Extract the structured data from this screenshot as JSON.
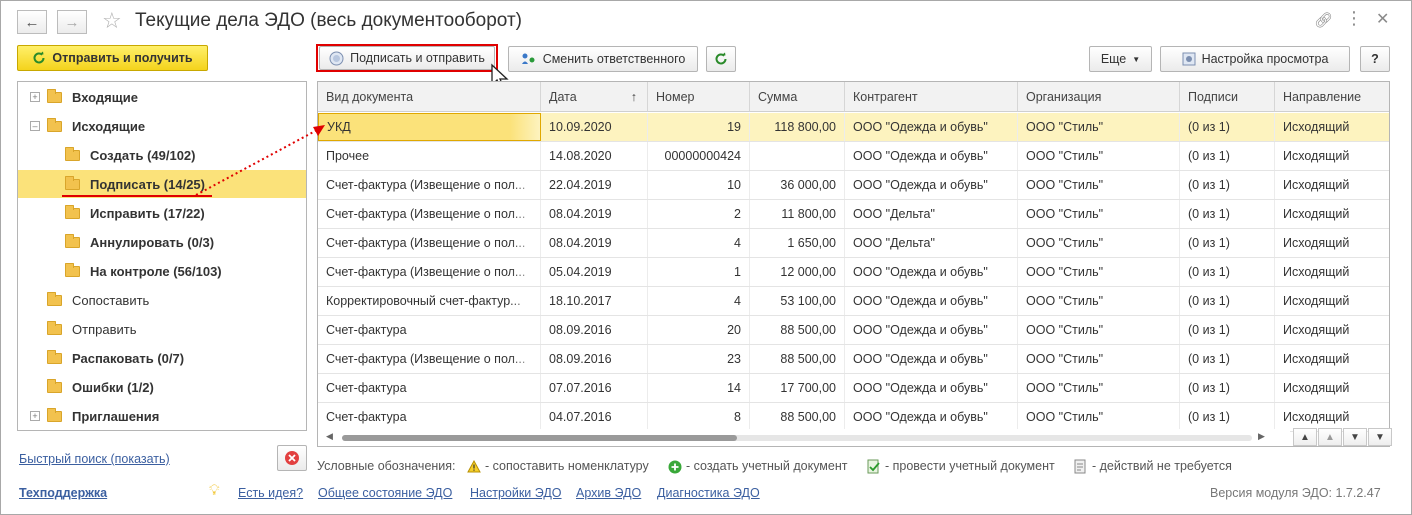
{
  "window": {
    "title": "Текущие дела ЭДО (весь документооборот)"
  },
  "toolbar": {
    "send_receive": "Отправить и получить",
    "sign_send": "Подписать и отправить",
    "change_responsible": "Сменить ответственного",
    "more": "Еще",
    "view_settings": "Настройка просмотра",
    "help": "?"
  },
  "tree": {
    "items": [
      {
        "label": "Входящие"
      },
      {
        "label": "Исходящие"
      },
      {
        "label": "Создать (49/102)"
      },
      {
        "label": "Подписать (14/25)"
      },
      {
        "label": "Исправить (17/22)"
      },
      {
        "label": "Аннулировать (0/3)"
      },
      {
        "label": "На контроле (56/103)"
      },
      {
        "label": "Сопоставить"
      },
      {
        "label": "Отправить"
      },
      {
        "label": "Распаковать (0/7)"
      },
      {
        "label": "Ошибки (1/2)"
      },
      {
        "label": "Приглашения"
      }
    ]
  },
  "grid": {
    "columns": [
      "Вид документа",
      "Дата",
      "Номер",
      "Сумма",
      "Контрагент",
      "Организация",
      "Подписи",
      "Направление"
    ],
    "sort_indicator": "↑",
    "rows": [
      [
        "УКД",
        "10.09.2020",
        "19",
        "118 800,00",
        "ООО \"Одежда и обувь\"",
        "ООО \"Стиль\"",
        "(0 из 1)",
        "Исходящий"
      ],
      [
        "Прочее",
        "14.08.2020",
        "00000000424",
        "",
        "ООО \"Одежда и обувь\"",
        "ООО \"Стиль\"",
        "(0 из 1)",
        "Исходящий"
      ],
      [
        "Счет-фактура (Извещение о пол...",
        "22.04.2019",
        "10",
        "36 000,00",
        "ООО \"Одежда и обувь\"",
        "ООО \"Стиль\"",
        "(0 из 1)",
        "Исходящий"
      ],
      [
        "Счет-фактура (Извещение о пол...",
        "08.04.2019",
        "2",
        "11 800,00",
        "ООО \"Дельта\"",
        "ООО \"Стиль\"",
        "(0 из 1)",
        "Исходящий"
      ],
      [
        "Счет-фактура (Извещение о пол...",
        "08.04.2019",
        "4",
        "1 650,00",
        "ООО \"Дельта\"",
        "ООО \"Стиль\"",
        "(0 из 1)",
        "Исходящий"
      ],
      [
        "Счет-фактура (Извещение о пол...",
        "05.04.2019",
        "1",
        "12 000,00",
        "ООО \"Одежда и обувь\"",
        "ООО \"Стиль\"",
        "(0 из 1)",
        "Исходящий"
      ],
      [
        "Корректировочный счет-фактур...",
        "18.10.2017",
        "4",
        "53 100,00",
        "ООО \"Одежда и обувь\"",
        "ООО \"Стиль\"",
        "(0 из 1)",
        "Исходящий"
      ],
      [
        "Счет-фактура",
        "08.09.2016",
        "20",
        "88 500,00",
        "ООО \"Одежда и обувь\"",
        "ООО \"Стиль\"",
        "(0 из 1)",
        "Исходящий"
      ],
      [
        "Счет-фактура (Извещение о пол...",
        "08.09.2016",
        "23",
        "88 500,00",
        "ООО \"Одежда и обувь\"",
        "ООО \"Стиль\"",
        "(0 из 1)",
        "Исходящий"
      ],
      [
        "Счет-фактура",
        "07.07.2016",
        "14",
        "17 700,00",
        "ООО \"Одежда и обувь\"",
        "ООО \"Стиль\"",
        "(0 из 1)",
        "Исходящий"
      ],
      [
        "Счет-фактура",
        "04.07.2016",
        "8",
        "88 500,00",
        "ООО \"Одежда и обувь\"",
        "ООО \"Стиль\"",
        "(0 из 1)",
        "Исходящий"
      ]
    ]
  },
  "legend": {
    "label": "Условные обозначения:",
    "items": [
      "- сопоставить номенклатуру",
      "- создать учетный документ",
      "- провести учетный документ",
      "- действий не требуется"
    ]
  },
  "footer": {
    "quick_search": "Быстрый поиск (показать)",
    "support": "Техподдержка",
    "idea": "Есть идея?",
    "status": "Общее состояние ЭДО",
    "settings": "Настройки ЭДО",
    "archive": "Архив ЭДО",
    "diagnostics": "Диагностика ЭДО",
    "version": "Версия модуля ЭДО: 1.7.2.47"
  },
  "colors": {
    "selection": "#fbe27a",
    "selected_row": "#fdf3bf",
    "accent_red": "#e00000",
    "link": "#3b5fa0"
  }
}
